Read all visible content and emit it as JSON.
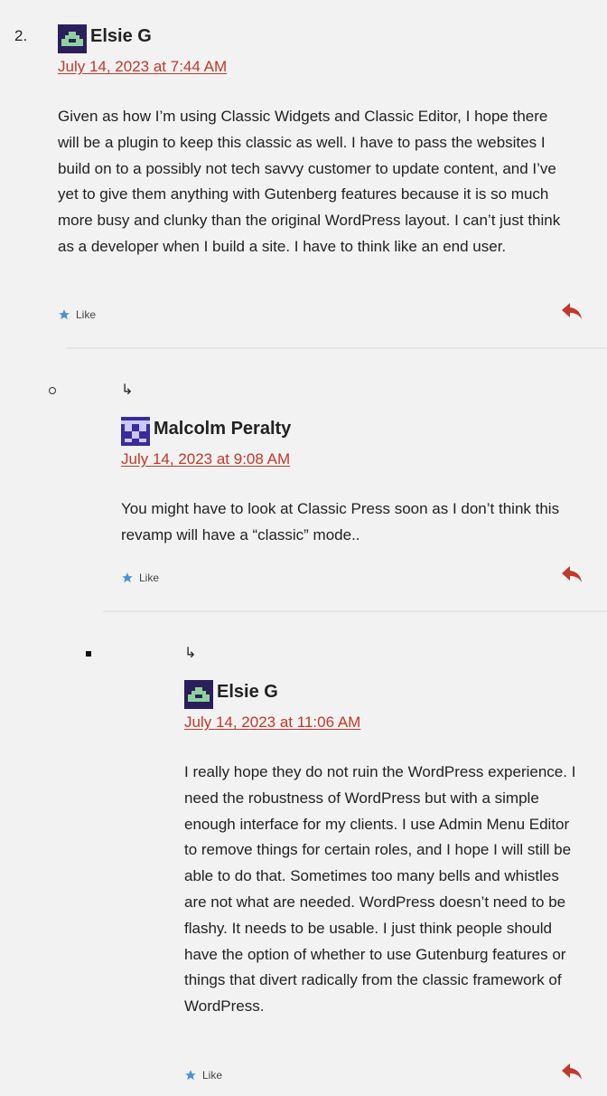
{
  "comment_number": "2.",
  "comments": [
    {
      "author": "Elsie G",
      "date": "July 14, 2023 at 7:44 AM",
      "text": "Given as how I’m using Classic Widgets and Classic Editor, I hope there will be a plugin to keep this classic as well. I have to pass the websites I build on to a possibly not tech savvy customer to update content, and I’ve yet to give them anything with Gutenberg features because it is so much more busy and clunky than the original WordPress layout. I can’t just think as a developer when I build a site. I have to think like an end user.",
      "like_label": "Like",
      "avatar_color": "#2a1f5a",
      "avatar_accent": "#8fd19e"
    },
    {
      "author": "Malcolm Peralty",
      "date": "July 14, 2023 at 9:08 AM",
      "text": "You might have to look at Classic Press soon as I don’t think this revamp will have a “classic” mode..",
      "like_label": "Like",
      "reply_arrow": "↳",
      "avatar_color": "#3b2b9a",
      "avatar_accent": "#c8c8ff"
    },
    {
      "author": "Elsie G",
      "date": "July 14, 2023 at 11:06 AM",
      "text": "I really hope they do not ruin the WordPress experience. I need the robustness of WordPress but with a simple enough interface for my clients. I use Admin Menu Editor to remove things for certain roles, and I hope I will still be able to do that. Sometimes too many bells and whistles are not what are needed. WordPress doesn’t need to be flashy. It needs to be usable. I just think people should have the option of whether to use Gutenburg features or things that divert radically from the classic framework of WordPress.",
      "like_label": "Like",
      "reply_arrow": "↳",
      "avatar_color": "#2a1f5a",
      "avatar_accent": "#8fd19e"
    }
  ],
  "colors": {
    "link": "#c0392b",
    "background": "#f2f2f2",
    "separator": "#e6e6e6",
    "like_star": "#4a90d9"
  },
  "icons": {
    "like": "star-icon",
    "reply": "reply-icon"
  }
}
